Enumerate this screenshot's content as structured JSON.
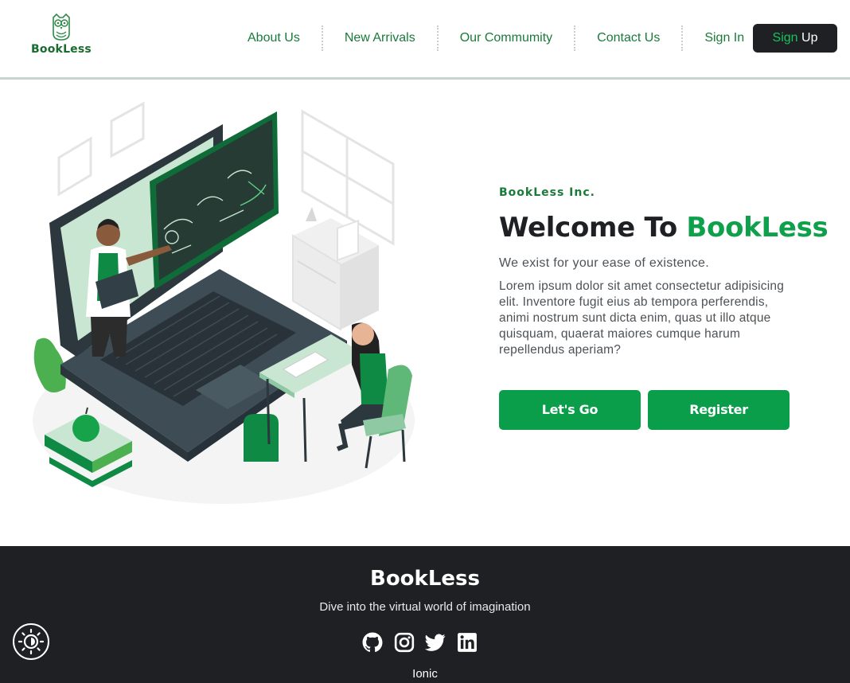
{
  "brand": {
    "logo_text": "BookLess",
    "logo_icon": "owl-icon"
  },
  "nav": {
    "items": [
      "About Us",
      "New Arrivals",
      "Our Commumity",
      "Contact Us",
      "Sign In"
    ],
    "signup_first": "Sign",
    "signup_second": " Up"
  },
  "hero": {
    "company": "BookLess Inc.",
    "welcome_prefix": "Welcome To ",
    "welcome_brand": "BookLess",
    "tagline": "We exist for your ease of existence.",
    "body": "Lorem ipsum dolor sit amet consectetur adipisicing elit. Inventore fugit eius ab tempora perferendis, animi nostrum sunt dicta enim, quas ut illo atque quisquam, quaerat maiores cumque harum repellendus aperiam?",
    "btn_primary": "Let's Go",
    "btn_secondary": "Register",
    "illustration": "online-class-illustration"
  },
  "footer": {
    "brand": "BookLess",
    "tagline": "Dive into the virtual world of imagination",
    "socials": [
      "github-icon",
      "instagram-icon",
      "twitter-icon",
      "linkedin-icon"
    ],
    "credit": "Ionic"
  },
  "colors": {
    "accent": "#0b9e4a",
    "dark": "#1e2024",
    "nav_text": "#1a7a3a"
  }
}
